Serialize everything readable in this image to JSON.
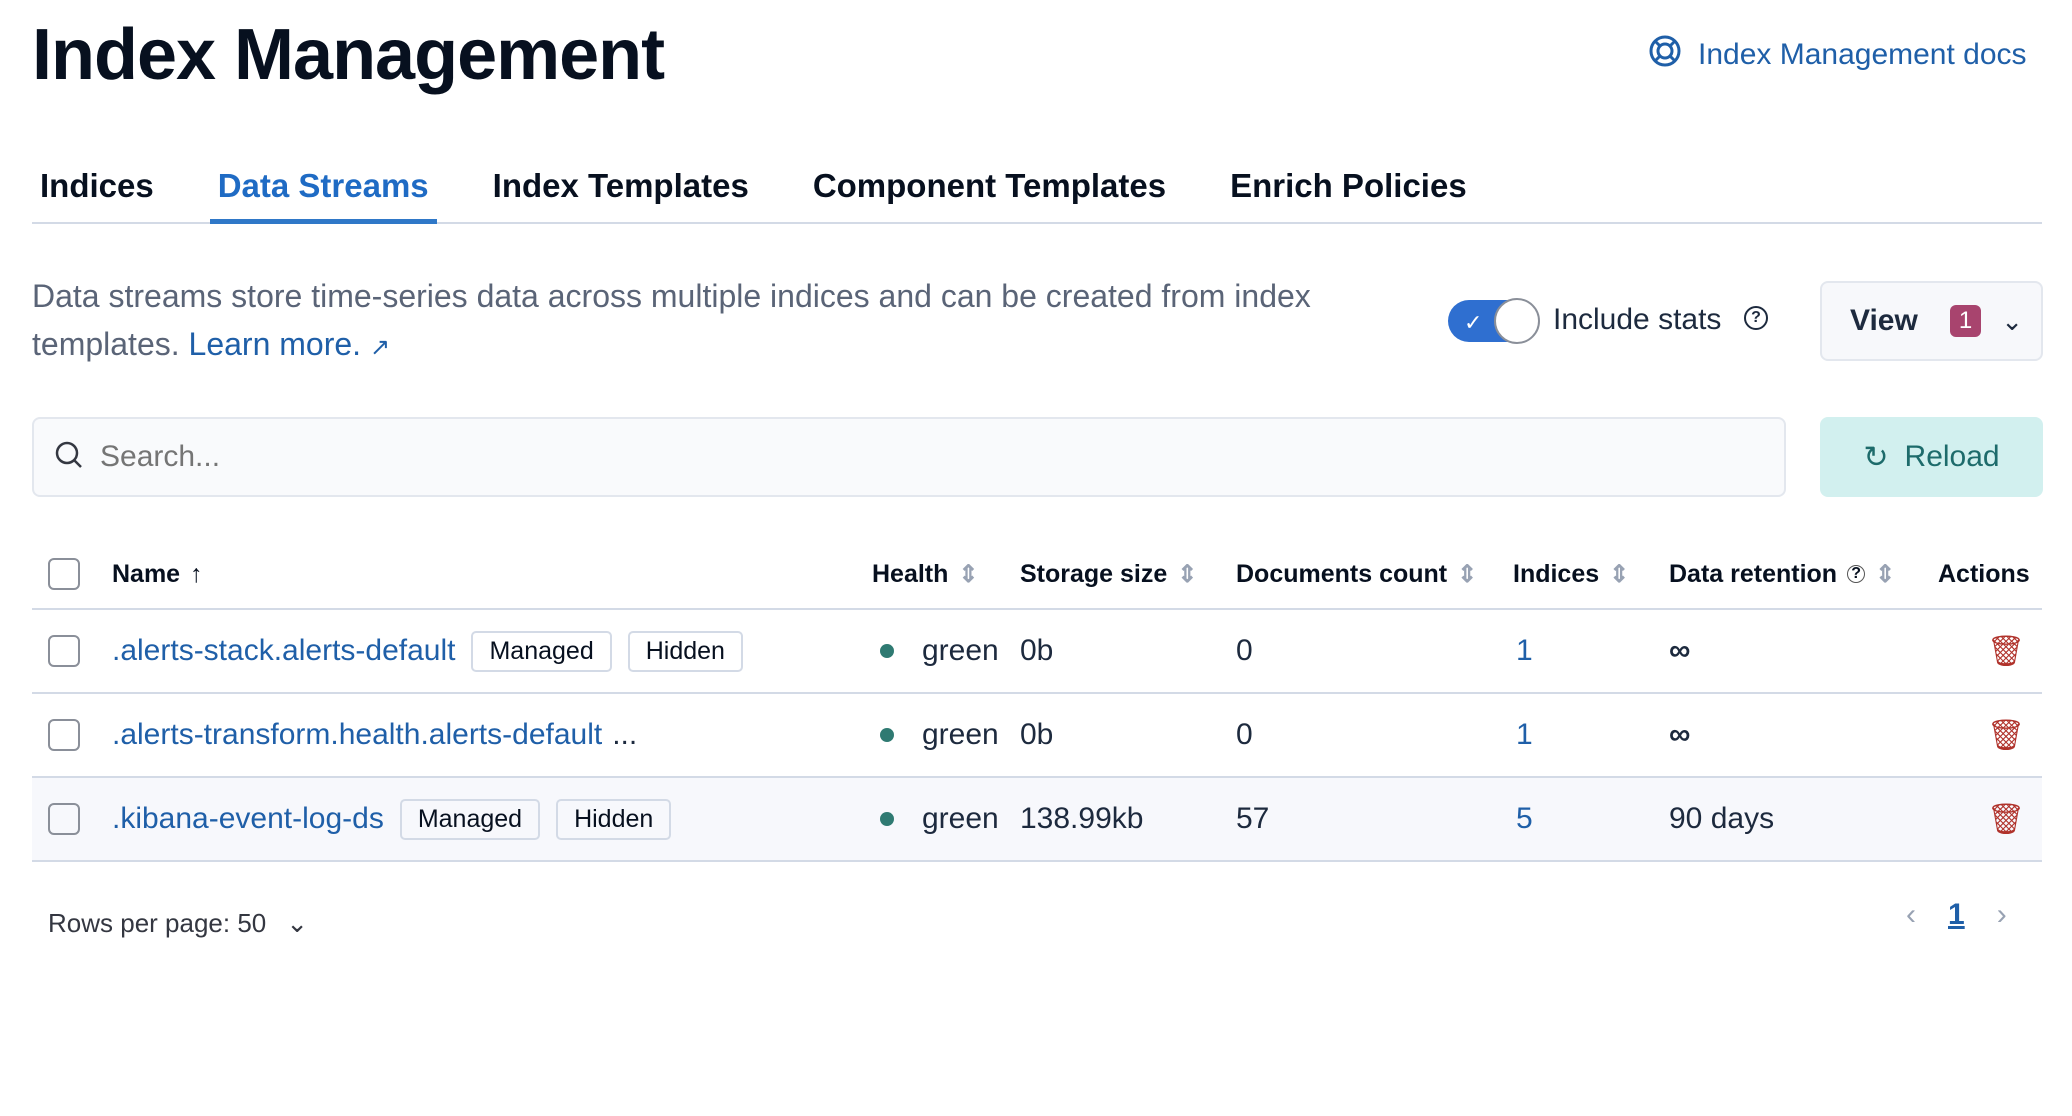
{
  "page": {
    "title": "Index Management",
    "docs_link": "Index Management docs"
  },
  "tabs": [
    {
      "label": "Indices"
    },
    {
      "label": "Data Streams"
    },
    {
      "label": "Index Templates"
    },
    {
      "label": "Component Templates"
    },
    {
      "label": "Enrich Policies"
    }
  ],
  "description": {
    "text": "Data streams store time-series data across multiple indices and can be created from index templates.",
    "learn_more": "Learn more."
  },
  "toolbar": {
    "include_stats": "Include stats",
    "include_stats_on": true,
    "view_label": "View",
    "view_badge": "1",
    "search_placeholder": "Search...",
    "reload_label": "Reload"
  },
  "table": {
    "headers": {
      "name": "Name",
      "health": "Health",
      "storage": "Storage size",
      "docs": "Documents count",
      "indices": "Indices",
      "retention": "Data retention",
      "actions": "Actions"
    },
    "rows": [
      {
        "name": ".alerts-stack.alerts-default",
        "tags": [
          "Managed",
          "Hidden"
        ],
        "health": "green",
        "storage": "0b",
        "docs": "0",
        "indices": "1",
        "retention": "∞"
      },
      {
        "name": ".alerts-transform.health.alerts-default",
        "suffix": "...",
        "tags": [],
        "health": "green",
        "storage": "0b",
        "docs": "0",
        "indices": "1",
        "retention": "∞"
      },
      {
        "name": ".kibana-event-log-ds",
        "tags": [
          "Managed",
          "Hidden"
        ],
        "health": "green",
        "storage": "138.99kb",
        "docs": "57",
        "indices": "5",
        "retention": "90 days"
      }
    ]
  },
  "footer": {
    "rows_per_page": "Rows per page: 50",
    "current_page": "1"
  }
}
